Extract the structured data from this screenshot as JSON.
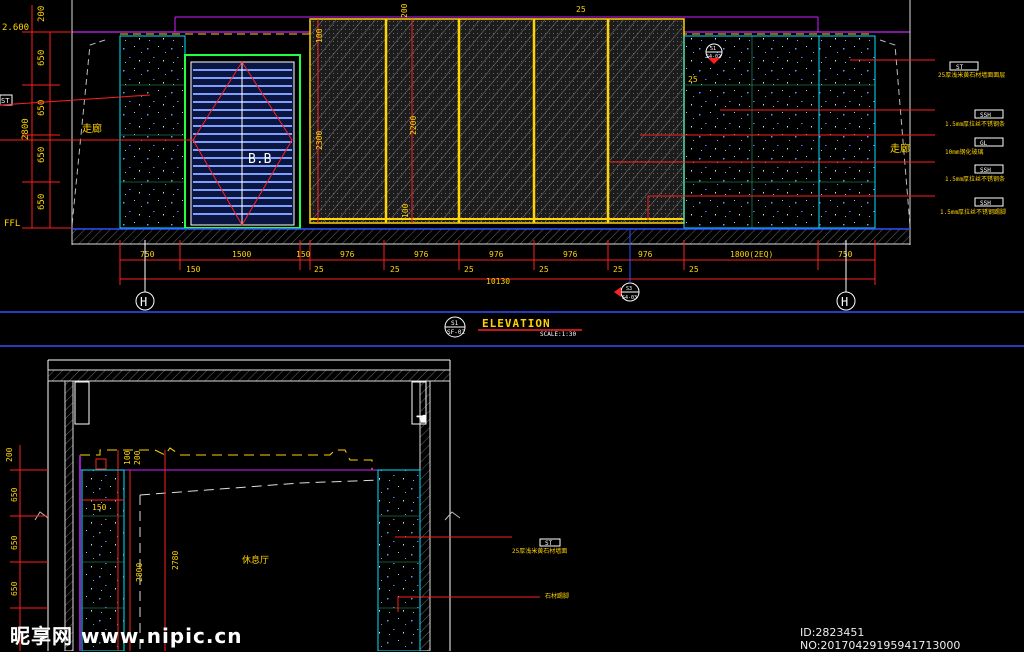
{
  "elevation": {
    "title": "ELEVATION",
    "scale": "SCALE:1:30",
    "tag_top": "S1",
    "tag_bottom": "SF-02",
    "grid_left": "H",
    "grid_right": "H",
    "section_tag_top": "S3",
    "section_tag_bottom": "S4-03",
    "detail_tag_top": "S1",
    "detail_tag_bottom": "S4-02",
    "level_top": "2.600",
    "level_floor": "FFL",
    "left_dims": [
      "200",
      "650",
      "650",
      "650",
      "650"
    ],
    "left_total": "2800",
    "inner_dims": [
      "100",
      "2300",
      "2200",
      "100"
    ],
    "top_dims": [
      "200",
      "25"
    ],
    "bottom_dims": [
      "750",
      "1500",
      "150",
      "976",
      "976",
      "976",
      "976",
      "976",
      "1800(2EQ)",
      "750"
    ],
    "bottom_sub_dims": [
      "150",
      "25",
      "25",
      "25",
      "25",
      "25",
      "25"
    ],
    "total": "10130",
    "door_label": "B.B",
    "corridor_left": "走廊",
    "corridor_right": "走廊",
    "side_dim": "25",
    "callouts": [
      {
        "code": "ST",
        "text": "25厚浅米黄石材墙面面层"
      },
      {
        "code": "SSH",
        "text": "1.5mm厚拉丝不锈钢条"
      },
      {
        "code": "GL",
        "text": "10mm钢化玻璃"
      },
      {
        "code": "SSH",
        "text": "1.5mm厚拉丝不锈钢条"
      },
      {
        "code": "SSH",
        "text": "1.5mm厚拉丝不锈钢踢脚"
      }
    ],
    "left_tag_code": "ST"
  },
  "section": {
    "left_dims": [
      "200",
      "650",
      "650",
      "650"
    ],
    "inner_dims": [
      "100",
      "200",
      "2800",
      "2780"
    ],
    "dim_150": "150",
    "room_label": "休息厅",
    "callouts": [
      {
        "code": "ST",
        "text": "25厚浅米黄石材墙面"
      },
      {
        "code": "",
        "text": "石材踢脚"
      }
    ]
  },
  "watermark": {
    "logo": "昵享网 www.nipic.cn",
    "id_text": "ID:2823451 NO:20170429195941713000"
  },
  "colors": {
    "yellow": "#ffd400",
    "red": "#ff2020",
    "cyan": "#00e5ff",
    "green": "#20ff40",
    "magenta": "#d020ff",
    "white": "#ffffff",
    "blue": "#3050ff",
    "gray": "#9a9a9a"
  }
}
